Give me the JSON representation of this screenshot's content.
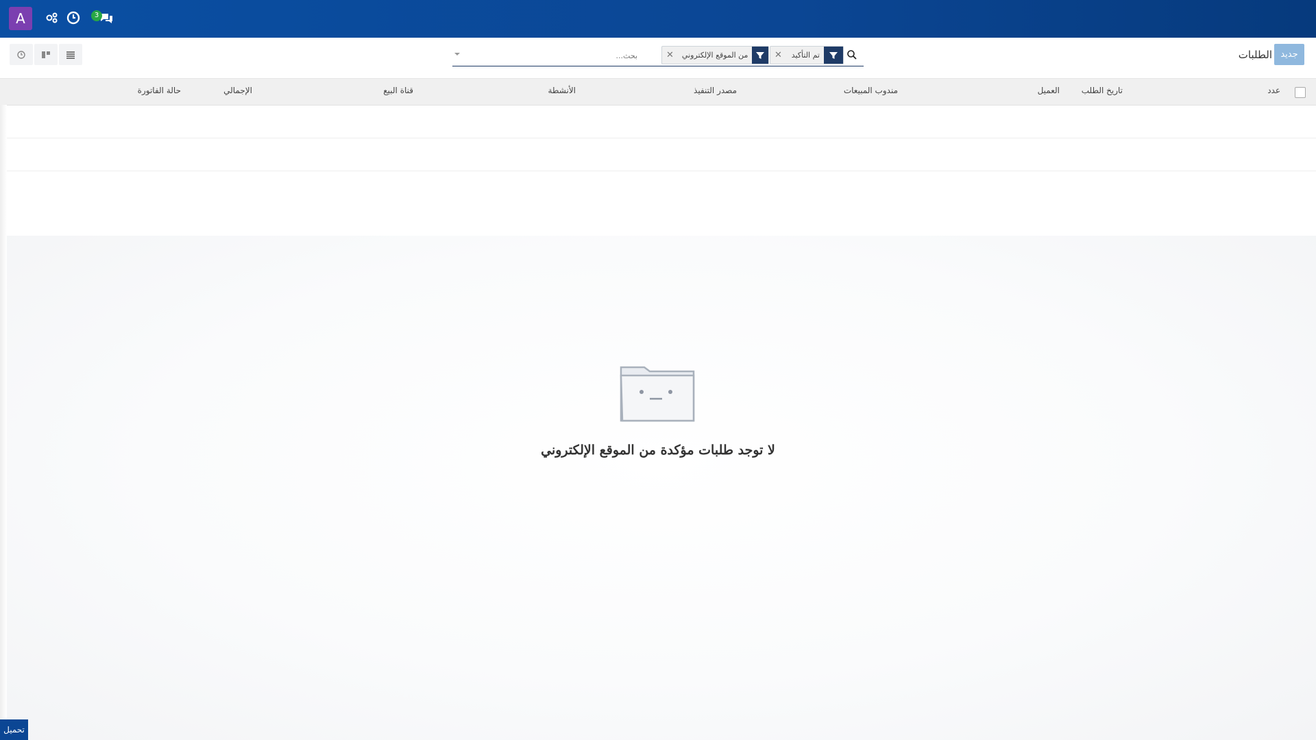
{
  "navbar": {
    "avatar_letter": "A",
    "chat_badge_count": "3",
    "icons": [
      "activity-icon",
      "clock-icon",
      "chat-icon"
    ]
  },
  "control_panel": {
    "new_button_label": "جديد",
    "title": "الطلبات",
    "search": {
      "placeholder": "بحث...",
      "facets": [
        {
          "label": "تم التأكيد"
        },
        {
          "label": "من الموقع الإلكتروني"
        }
      ]
    },
    "views": [
      "list-view-icon",
      "kanban-view-icon",
      "activity-view-icon"
    ]
  },
  "table": {
    "columns": [
      "عدد",
      "تاريخ الطلب",
      "العميل",
      "مندوب المبيعات",
      "مصدر التنفيذ",
      "الأنشطة",
      "قناة البيع",
      "الإجمالي",
      "حالة الفاتورة"
    ]
  },
  "empty_state": {
    "title": "لا توجد طلبات مؤكدة من الموقع الإلكتروني"
  },
  "footer": {
    "load_button_label": "تحميل"
  },
  "colors": {
    "navbar": "#0b4694",
    "avatar": "#7b3fb0",
    "badge": "#28a745",
    "facet_funnel": "#1f3b66",
    "new_button": "#8fb8de"
  }
}
